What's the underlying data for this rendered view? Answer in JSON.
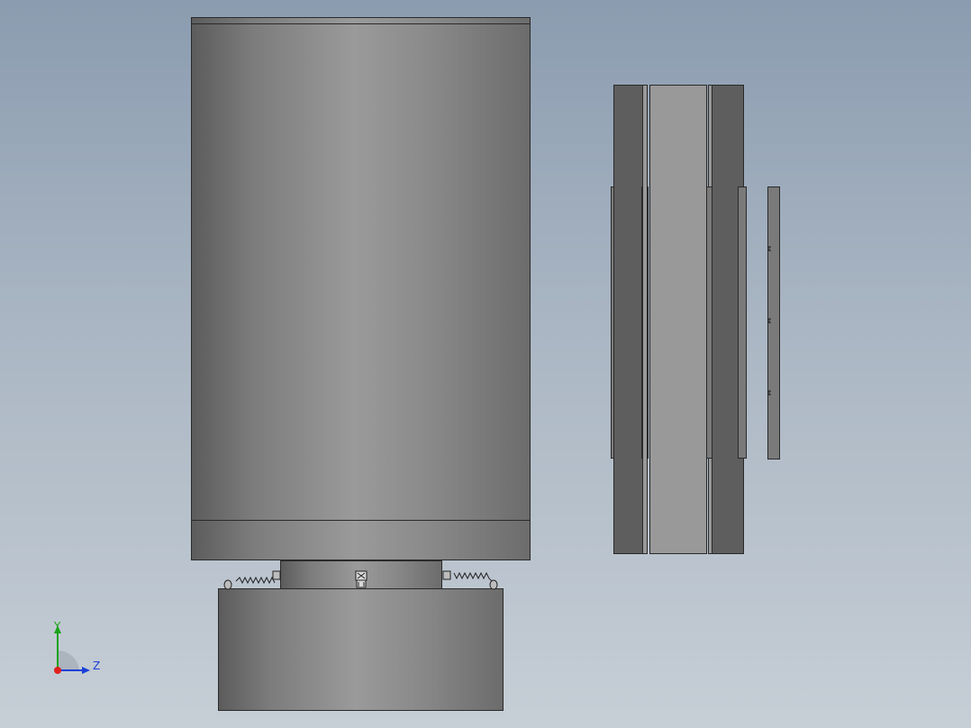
{
  "triad": {
    "y_label": "Y",
    "z_label": "Z",
    "colors": {
      "y_axis": "#1aa31a",
      "z_axis": "#1a3fd8",
      "origin": "#e0201c"
    }
  },
  "icons": [
    "spring-icon",
    "clip-icon",
    "view-triad-icon"
  ]
}
